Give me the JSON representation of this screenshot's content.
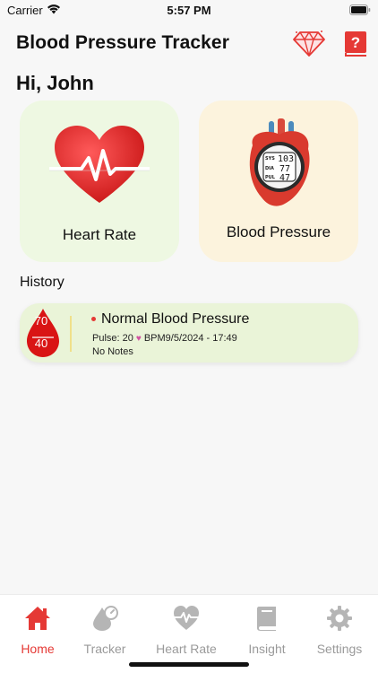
{
  "status_bar": {
    "carrier": "Carrier",
    "time": "5:57 PM"
  },
  "header": {
    "title": "Blood Pressure Tracker",
    "greeting": "Hi, John"
  },
  "cards": {
    "heart_rate_label": "Heart Rate",
    "blood_pressure_label": "Blood Pressure",
    "monitor": {
      "sys_label": "SYS",
      "sys_value": "103",
      "dia_label": "DIA",
      "dia_value": "77",
      "pul_label": "PUL",
      "pul_value": "47"
    }
  },
  "history": {
    "title": "History",
    "items": [
      {
        "systolic": "70",
        "diastolic": "40",
        "status": "Normal Blood Pressure",
        "pulse_prefix": "Pulse: 20",
        "pulse_unit_datetime": "BPM9/5/2024 - 17:49",
        "notes": "No Notes"
      }
    ]
  },
  "tabs": [
    {
      "label": "Home",
      "icon": "home-icon",
      "active": true
    },
    {
      "label": "Tracker",
      "icon": "tracker-icon",
      "active": false
    },
    {
      "label": "Heart Rate",
      "icon": "heart-rate-icon",
      "active": false
    },
    {
      "label": "Insight",
      "icon": "book-icon",
      "active": false
    },
    {
      "label": "Settings",
      "icon": "gear-icon",
      "active": false
    }
  ],
  "colors": {
    "accent": "#e53935",
    "heart_card_bg": "#eef8e2",
    "bp_card_bg": "#fcf3dd",
    "history_bg": "#eaf4d8",
    "inactive_tab": "#9a9a9a"
  }
}
